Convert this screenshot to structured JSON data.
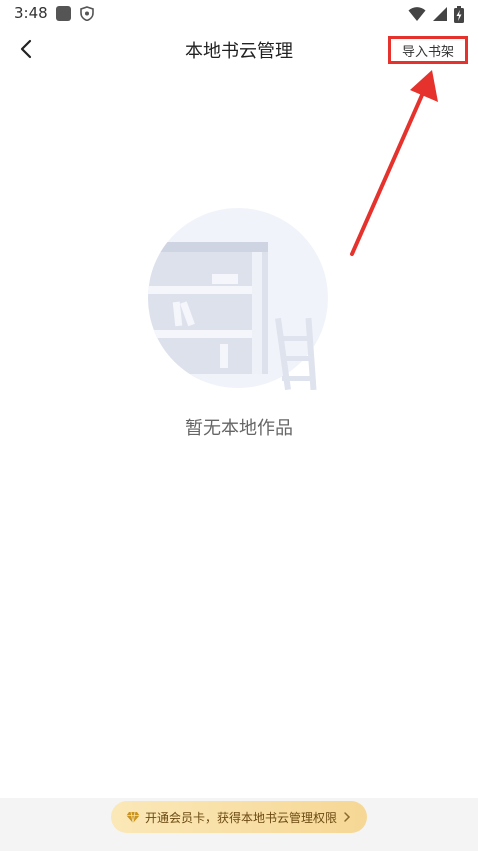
{
  "status_bar": {
    "time": "3:48"
  },
  "header": {
    "title": "本地书云管理",
    "import_label": "导入书架"
  },
  "empty_state": {
    "message": "暂无本地作品"
  },
  "promo": {
    "label": "开通会员卡，获得本地书云管理权限"
  },
  "colors": {
    "annotation_red": "#e5322d",
    "promo_gold": "#f6d795"
  }
}
